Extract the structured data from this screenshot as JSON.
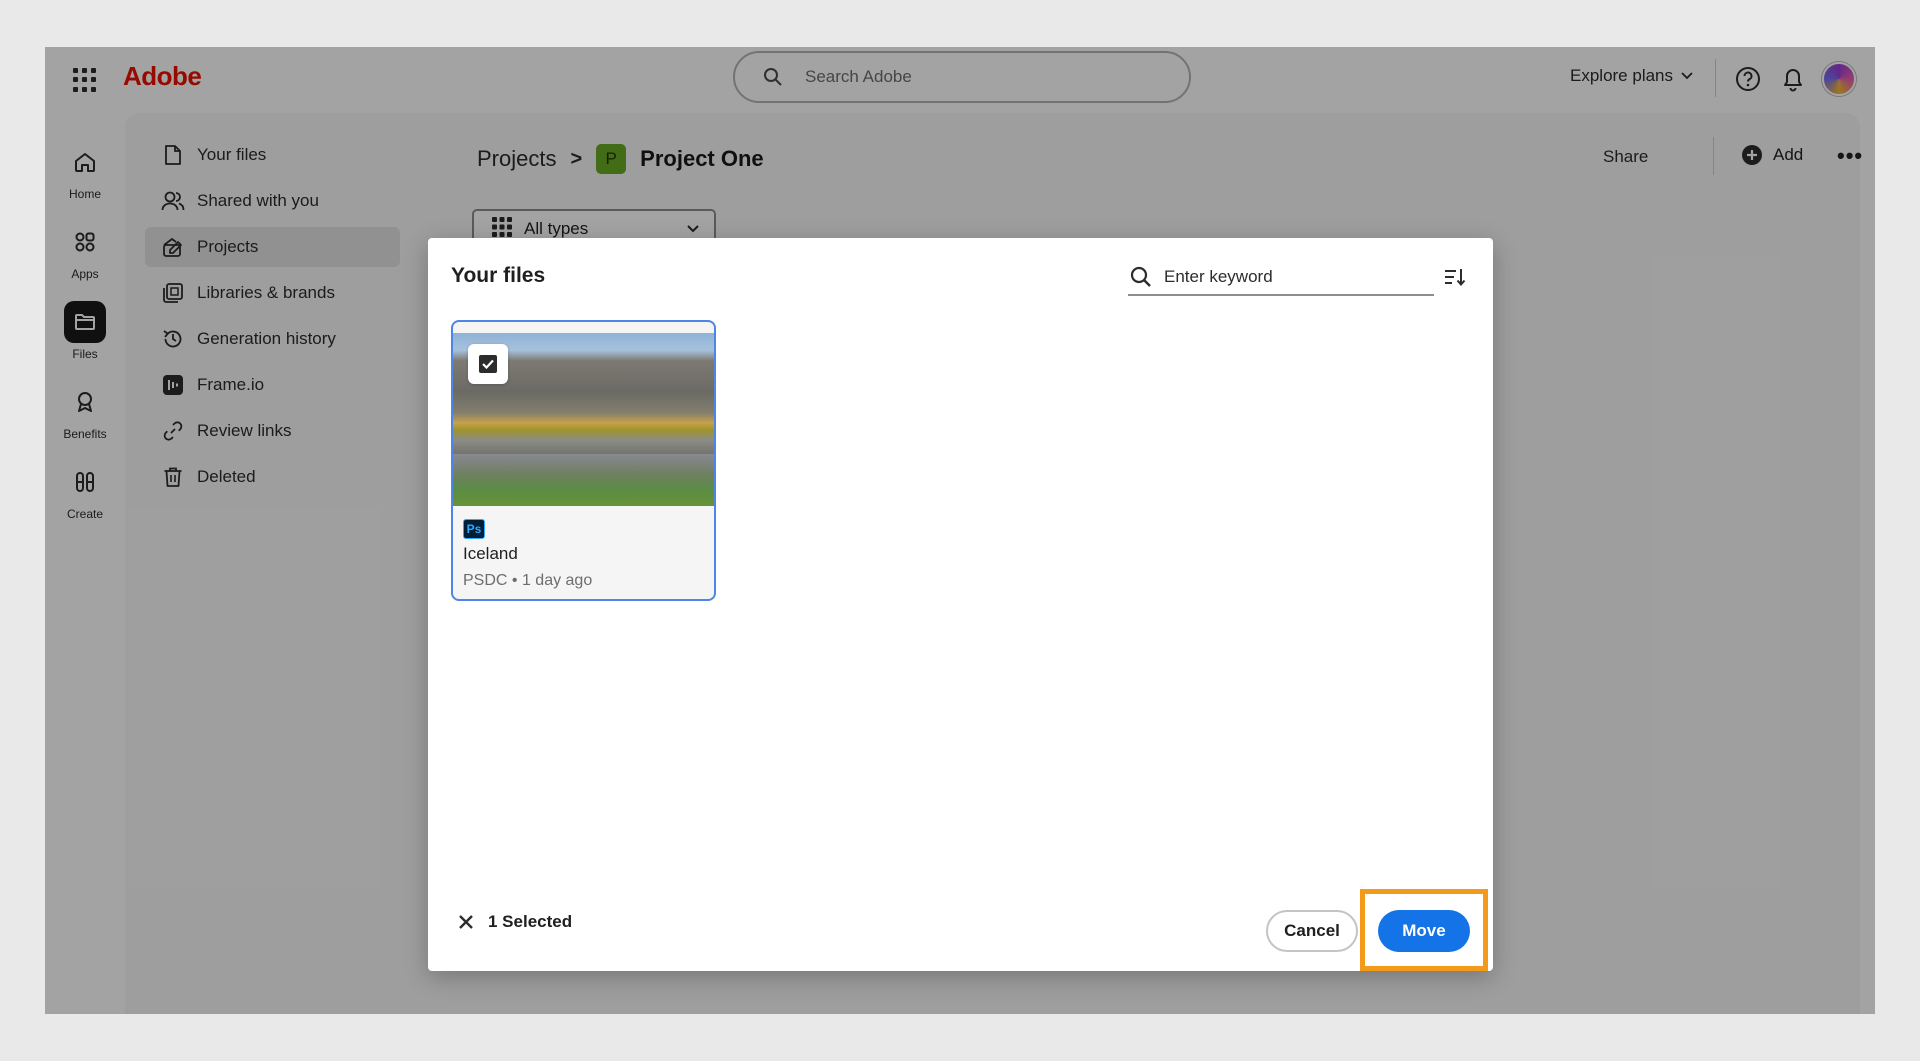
{
  "header": {
    "logo": "Adobe",
    "search_placeholder": "Search Adobe",
    "explore": "Explore plans",
    "icons": [
      "apps-grid-icon",
      "search-icon",
      "chevron-down-icon",
      "help-icon",
      "bell-icon",
      "avatar"
    ]
  },
  "rail": [
    {
      "label": "Home",
      "icon": "home-icon"
    },
    {
      "label": "Apps",
      "icon": "apps-icon"
    },
    {
      "label": "Files",
      "icon": "folder-icon",
      "active": true
    },
    {
      "label": "Benefits",
      "icon": "award-icon"
    },
    {
      "label": "Create",
      "icon": "create-icon"
    }
  ],
  "nav": [
    {
      "label": "Your files",
      "icon": "file-icon"
    },
    {
      "label": "Shared with you",
      "icon": "people-icon"
    },
    {
      "label": "Projects",
      "icon": "projects-icon",
      "active": true
    },
    {
      "label": "Libraries & brands",
      "icon": "library-icon"
    },
    {
      "label": "Generation history",
      "icon": "history-icon"
    },
    {
      "label": "Frame.io",
      "icon": "frameio-icon"
    },
    {
      "label": "Review links",
      "icon": "link-icon"
    },
    {
      "label": "Deleted",
      "icon": "trash-icon"
    }
  ],
  "breadcrumb": {
    "root": "Projects",
    "separator": ">",
    "badge": "P",
    "current": "Project One"
  },
  "filter": {
    "label": "All types"
  },
  "actions": {
    "share": "Share",
    "add": "Add",
    "more": "•••"
  },
  "dialog": {
    "title": "Your files",
    "keyword_placeholder": "Enter keyword",
    "file": {
      "app_badge": "Ps",
      "name": "Iceland",
      "meta": "PSDC • 1 day ago",
      "checked": true
    },
    "selected": "1 Selected",
    "cancel": "Cancel",
    "move": "Move"
  },
  "colors": {
    "accent": "#1473e6",
    "brand": "#eb1000",
    "highlight": "#f39a1b",
    "project_badge": "#6aa923"
  }
}
